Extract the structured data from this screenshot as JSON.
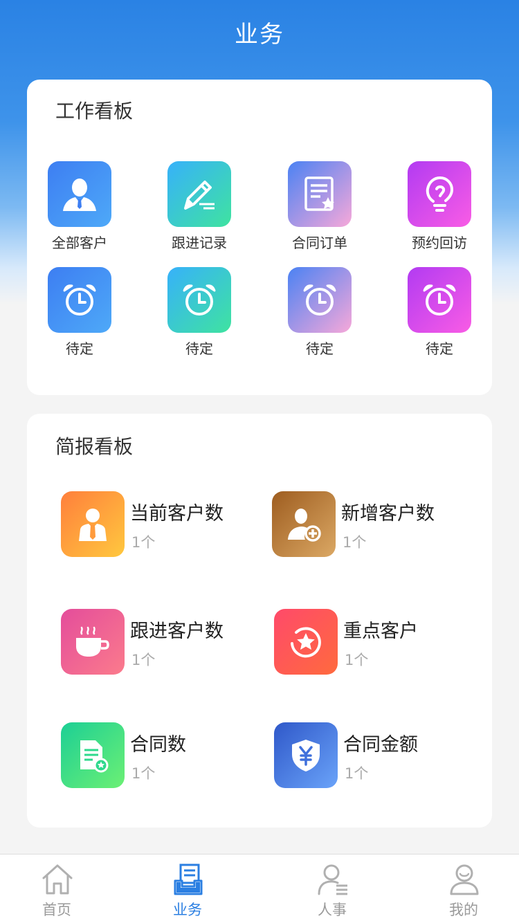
{
  "header": {
    "title": "业务"
  },
  "work_board": {
    "title": "工作看板",
    "items": [
      {
        "label": "全部客户",
        "icon": "user-icon",
        "gradient": "blue"
      },
      {
        "label": "跟进记录",
        "icon": "pencil-icon",
        "gradient": "cyan"
      },
      {
        "label": "合同订单",
        "icon": "document-star-icon",
        "gradient": "purplepink"
      },
      {
        "label": "预约回访",
        "icon": "lightbulb-icon",
        "gradient": "violet"
      },
      {
        "label": "待定",
        "icon": "alarm-clock-icon",
        "gradient": "blue"
      },
      {
        "label": "待定",
        "icon": "alarm-clock-icon",
        "gradient": "cyan"
      },
      {
        "label": "待定",
        "icon": "alarm-clock-icon",
        "gradient": "purplepink"
      },
      {
        "label": "待定",
        "icon": "alarm-clock-icon",
        "gradient": "violet"
      }
    ]
  },
  "brief_board": {
    "title": "简报看板",
    "stats": [
      {
        "label": "当前客户数",
        "value": "1个",
        "icon": "business-person-icon"
      },
      {
        "label": "新增客户数",
        "value": "1个",
        "icon": "add-user-icon"
      },
      {
        "label": "跟进客户数",
        "value": "1个",
        "icon": "coffee-cup-icon"
      },
      {
        "label": "重点客户",
        "value": "1个",
        "icon": "star-circle-icon"
      },
      {
        "label": "合同数",
        "value": "1个",
        "icon": "contract-doc-icon"
      },
      {
        "label": "合同金额",
        "value": "1个",
        "icon": "yuan-shield-icon"
      }
    ]
  },
  "tabbar": {
    "items": [
      {
        "label": "首页",
        "icon": "home-icon",
        "active": false
      },
      {
        "label": "业务",
        "icon": "business-inbox-icon",
        "active": true
      },
      {
        "label": "人事",
        "icon": "person-list-icon",
        "active": false
      },
      {
        "label": "我的",
        "icon": "profile-icon",
        "active": false
      }
    ]
  },
  "colors": {
    "primary": "#2b7fe2",
    "header_gradient_top": "#2a82e4",
    "background": "#f4f4f4",
    "inactive_tab": "#9a9a9a"
  }
}
